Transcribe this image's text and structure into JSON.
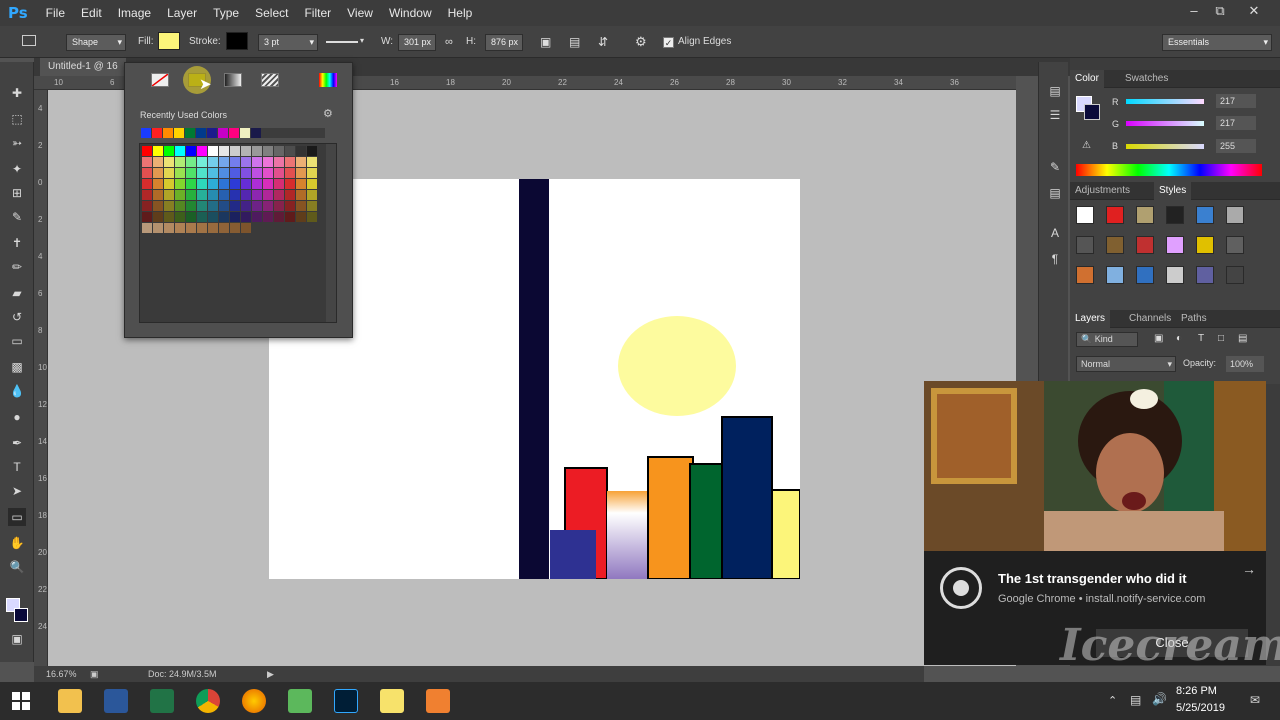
{
  "app": {
    "logo": "Ps"
  },
  "menu": [
    "File",
    "Edit",
    "Image",
    "Layer",
    "Type",
    "Select",
    "Filter",
    "View",
    "Window",
    "Help"
  ],
  "options_bar": {
    "mode": "Shape",
    "fill_label": "Fill:",
    "fill_color": "#fcf57a",
    "stroke_label": "Stroke:",
    "stroke_color": "#000000",
    "stroke_width": "3 pt",
    "w_label": "W:",
    "w_value": "301 px",
    "h_label": "H:",
    "h_value": "876 px",
    "align_edges": "Align Edges",
    "workspace": "Essentials"
  },
  "document": {
    "tab_title": "Untitled-1 @ 16",
    "zoom": "16.67%",
    "doc_size": "Doc: 24.9M/3.5M"
  },
  "ruler_top": [
    "10",
    "6",
    "8",
    "10",
    "12",
    "14",
    "16",
    "18",
    "20",
    "22",
    "24",
    "26",
    "28",
    "30",
    "32",
    "34",
    "36"
  ],
  "ruler_left": [
    "4",
    "2",
    "0",
    "2",
    "4",
    "6",
    "8",
    "10",
    "12",
    "14",
    "16",
    "18",
    "20",
    "22",
    "24"
  ],
  "fill_picker": {
    "recent_label": "Recently Used Colors",
    "recent_colors": [
      "#1a3cff",
      "#ff2020",
      "#ff8a00",
      "#ffd200",
      "#007a33",
      "#003a8c",
      "#1c1c8c",
      "#c800c8",
      "#ff0080",
      "#f0f0c0",
      "#1a1a4a"
    ]
  },
  "color_panel": {
    "tab1": "Color",
    "tab2": "Swatches",
    "r_label": "R",
    "r_value": "217",
    "g_label": "G",
    "g_value": "217",
    "b_label": "B",
    "b_value": "255"
  },
  "styles_panel": {
    "tab1": "Adjustments",
    "tab2": "Styles"
  },
  "layers_panel": {
    "tab1": "Layers",
    "tab2": "Channels",
    "tab3": "Paths",
    "kind": "Kind",
    "blend": "Normal",
    "opacity_label": "Opacity:",
    "opacity_value": "100%"
  },
  "notification": {
    "title": "The 1st transgender who did it",
    "source": "Google Chrome • install.notify-service.com",
    "close_label": "Close"
  },
  "watermark": "Icecream",
  "taskbar": {
    "time": "8:26 PM",
    "date": "5/25/2019"
  }
}
